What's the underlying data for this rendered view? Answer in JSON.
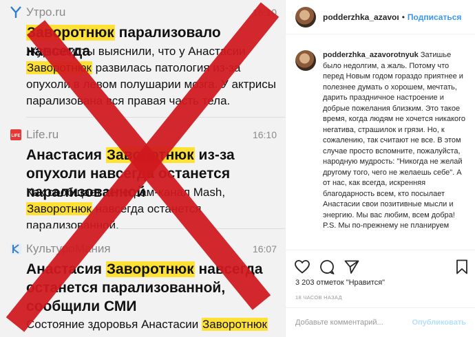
{
  "news": [
    {
      "source": "Утро.ru",
      "icon": "utro-logo-icon",
      "time": "16:10",
      "headline": [
        "",
        "Заворотнюк",
        " парализовало навсегда"
      ],
      "lead": [
        "Журналисты выяснили, что у Анастасии ",
        "Заворотнюк",
        " развилась патология из-за опухоли в левом полушарии мозга. У актрисы парализована вся правая часть тела."
      ]
    },
    {
      "source": "Life.ru",
      "icon": "life-logo-icon",
      "time": "16:10",
      "headline": [
        "Анастасия ",
        "Заворотнюк",
        " из-за опухоли навсегда останется парализованной"
      ],
      "lead": [
        "Как сообщает телеграм-канал Mash, ",
        "Заворотнюк",
        " навсегда останется парализованной."
      ]
    },
    {
      "source": "КультуроМания",
      "icon": "kulturomania-logo-icon",
      "time": "16:07",
      "headline": [
        "Анастасия ",
        "Заворотнюк",
        " навсегда останется парализованной, сообщили СМИ"
      ],
      "lead": [
        "Состояние здоровья Анастасии ",
        "Заворотнюк",
        ""
      ]
    }
  ],
  "highlight_color": "#ffe135",
  "cross_color": "#d0191f",
  "post": {
    "username": "podderzhka_azavorotnyuk",
    "header_username": "podderzhka_azavoı",
    "follow_label": "Подписаться",
    "caption": "Затишье было недолгим, а жаль. Потому что перед Новым годом гораздо приятнее и полезнее думать о хорошем, мечтать, дарить праздничное настроение и добрые пожелания близким. Это такое время, когда людям не хочется никакого негатива, страшилок и грязи. Но, к сожалению, так считают не все. В этом случае просто вспомните, пожалуйста, народную мудрость: \"Никогда не желай другому того, чего не желаешь себе\". А от нас, как всегда, искренняя благодарность всем, кто посылает Анастасии свои позитивные мысли и энергию. Мы вас любим, всем добра! P.S. Мы по-прежнему не планируем",
    "likes_text": "3 203 отметок \"Нравится\"",
    "time_ago": "18 ЧАСОВ НАЗАД",
    "comment_placeholder": "Добавьте комментарий...",
    "publish_label": "Опубликовать",
    "accent_color": "#3897f0"
  }
}
